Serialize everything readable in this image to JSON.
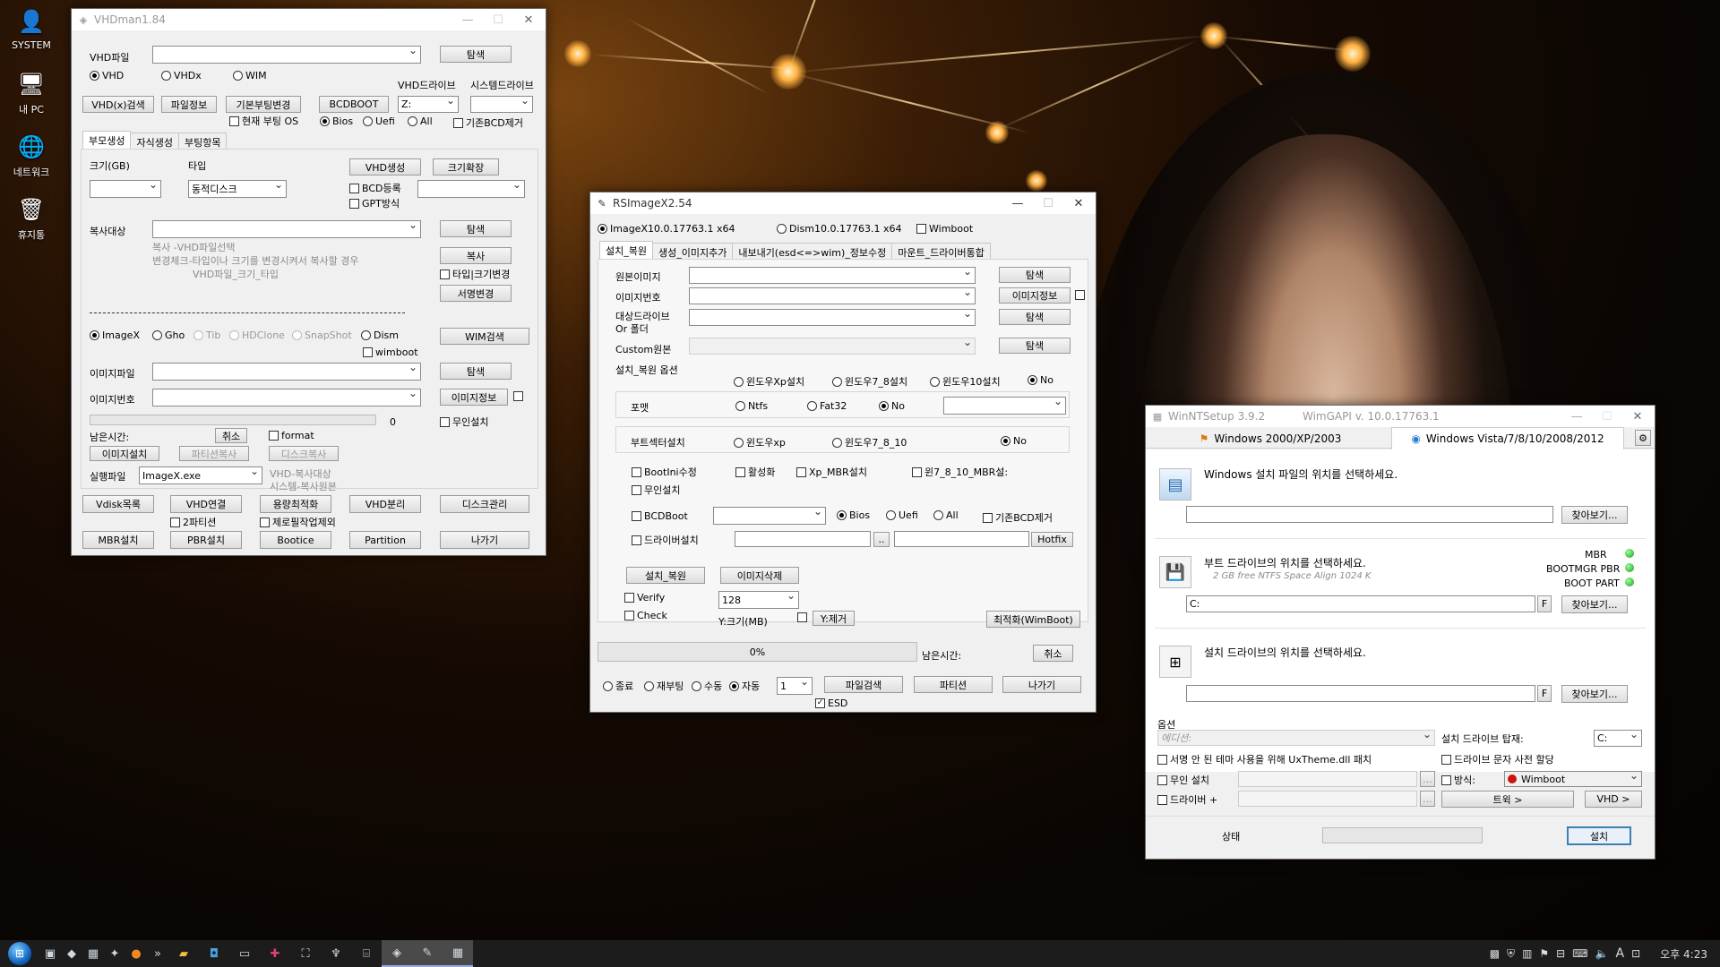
{
  "desktop": {
    "icons": [
      {
        "label": "SYSTEM",
        "icon": "user-folder-icon"
      },
      {
        "label": "내 PC",
        "icon": "computer-icon"
      },
      {
        "label": "네트워크",
        "icon": "network-icon"
      },
      {
        "label": "휴지통",
        "icon": "recycle-bin-icon"
      }
    ]
  },
  "vhdman": {
    "title": "VHDman1.84",
    "vhd_file_label": "VHD파일",
    "browse": "탐색",
    "type_radios": [
      "VHD",
      "VHDx",
      "WIM"
    ],
    "vhd_drive_label": "VHD드라이브",
    "sys_drive_label": "시스템드라이브",
    "buttons_row": [
      "VHD(x)검색",
      "파일정보",
      "기본부팅변경",
      "BCDBOOT"
    ],
    "drive_value": "Z:",
    "current_boot_os": "현재 부팅 OS",
    "bios": "Bios",
    "uefi": "Uefi",
    "all": "All",
    "remove_bcd": "기존BCD제거",
    "tabs": [
      "부모생성",
      "자식생성",
      "부팅항목"
    ],
    "size_label": "크기(GB)",
    "type_label": "타입",
    "type_value": "동적디스크",
    "vhd_create": "VHD생성",
    "size_expand": "크기확장",
    "bcd_register": "BCD등록",
    "gpt": "GPT방식",
    "copy_target_label": "복사대상",
    "copy_button": "복사",
    "type_size_change": "타입|크기변경",
    "sign_change": "서명변경",
    "copy_hint1": "복사      -VHD파일선택",
    "copy_hint2": "변경체크-타입이나 크기를 변경시켜서 복사할 경우",
    "copy_hint3": "VHD파일_크기_타입",
    "tool_radios": [
      "ImageX",
      "Gho",
      "Tib",
      "HDClone",
      "SnapShot",
      "Dism"
    ],
    "wim_search": "WIM검색",
    "wimboot": "wimboot",
    "image_file_label": "이미지파일",
    "image_num_label": "이미지번호",
    "image_info": "이미지정보",
    "progress_value": "0",
    "remain_label": "남은시간:",
    "cancel": "취소",
    "format": "format",
    "unattended": "무인설치",
    "install_buttons": [
      "이미지설치",
      "파티션복사",
      "디스크복사"
    ],
    "exec_label": "실행파일",
    "exec_value": "ImageX.exe",
    "exec_hint1": "VHD-복사대상",
    "exec_hint2": "시스템-복사원본",
    "bottom_row1": [
      "Vdisk목록",
      "VHD연결",
      "용량최적화",
      "VHD분리",
      "디스크관리"
    ],
    "two_partition": "2파티션",
    "zero_fill": "제로필작업제외",
    "bottom_row2": [
      "MBR설치",
      "PBR설치",
      "Bootice",
      "Partition",
      "나가기"
    ]
  },
  "rsimage": {
    "title": "RSImageX2.54",
    "engines": [
      "ImageX10.0.17763.1 x64",
      "Dism10.0.17763.1 x64"
    ],
    "wimboot": "Wimboot",
    "tabs": [
      "설치_복원",
      "생성_이미지추가",
      "내보내기(esd<=>wim)_정보수정",
      "마운트_드라이버통합"
    ],
    "source_image": "원본이미지",
    "image_num": "이미지번호",
    "target_drive1": "대상드라이브",
    "target_drive2": "Or 폴더",
    "custom_source": "Custom원본",
    "browse": "탐색",
    "image_info": "이미지정보",
    "options_title": "설치_복원 옵션",
    "win_radios": [
      "윈도우Xp설치",
      "윈도우7_8설치",
      "윈도우10설치",
      "No"
    ],
    "format_label": "포맷",
    "format_radios": [
      "Ntfs",
      "Fat32",
      "No"
    ],
    "bootsector_label": "부트섹터설치",
    "bootsector_radios": [
      "윈도우xp",
      "윈도우7_8_10",
      "No"
    ],
    "checks": [
      "BootIni수정",
      "활성화",
      "Xp_MBR설치",
      "윈7_8_10_MBR설:",
      "무인설치"
    ],
    "bcdboot": "BCDBoot",
    "bios": "Bios",
    "uefi": "Uefi",
    "all": "All",
    "remove_bcd": "기존BCD제거",
    "driver_install": "드라이버설치",
    "dots": "..",
    "hotfix": "Hotfix",
    "install_restore": "설치_복원",
    "image_delete": "이미지삭제",
    "verify": "Verify",
    "check": "Check",
    "size_value": "128",
    "y_size": "Y:크기(MB)",
    "y_remove": "Y:제거",
    "optimize": "최적화(WimBoot)",
    "progress": "0%",
    "remain": "남은시간:",
    "cancel": "취소",
    "end_radios": [
      "종료",
      "재부팅",
      "수동",
      "자동"
    ],
    "count_value": "1",
    "file_search": "파일검색",
    "partition": "파티션",
    "exit": "나가기",
    "esd": "ESD"
  },
  "winnt": {
    "title": "WinNTSetup 3.9.2",
    "wimgapi": "WimGAPI v. 10.0.17763.1",
    "tabs": [
      "Windows 2000/XP/2003",
      "Windows Vista/7/8/10/2008/2012"
    ],
    "s1_title": "Windows 설치 파일의 위치를 선택하세요.",
    "browse": "찾아보기...",
    "s2_title": "부트 드라이브의 위치를 선택하세요.",
    "s2_sub": "2 GB free NTFS Space Align 1024 K",
    "s2_value": "C:",
    "status_labels": [
      "MBR",
      "BOOTMGR PBR",
      "BOOT PART"
    ],
    "status_color": "#22aa22",
    "f": "F",
    "s3_title": "설치 드라이브의 위치를 선택하세요.",
    "options": "옵션",
    "edition_placeholder": "에디션:",
    "mount_label": "설치 드라이브 탑재:",
    "mount_value": "C:",
    "uxtheme": "서명 안 된 테마 사용을 위해 UxTheme.dll 패치",
    "letter_prealloc": "드라이브 문자 사전 할당",
    "unattended": "무인 설치",
    "method": "방식:",
    "method_value": "Wimboot",
    "method_color": "#cc1111",
    "driver": "드라이버 +",
    "tweaks": "트윅 >",
    "vhd": "VHD >",
    "status": "상태",
    "install": "설치"
  },
  "taskbar": {
    "time": "오후 4:23",
    "ime": "A",
    "start_icon": "windows-orb-icon"
  }
}
